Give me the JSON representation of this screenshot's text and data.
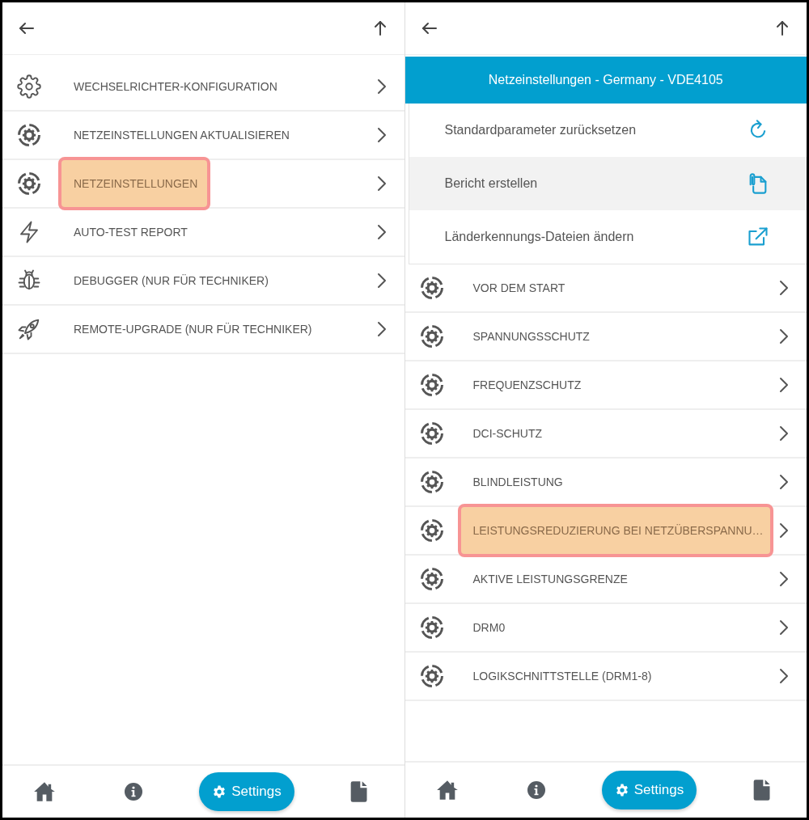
{
  "panels": [
    {
      "items": [
        {
          "label": "WECHSELRICHTER-KONFIGURATION",
          "kind": "gear",
          "highlighted": false
        },
        {
          "label": "NETZEINSTELLUNGEN AKTUALISIEREN",
          "kind": "gear-ring",
          "highlighted": false
        },
        {
          "label": "NETZEINSTELLUNGEN",
          "kind": "gear-ring",
          "highlighted": true
        },
        {
          "label": "AUTO-TEST REPORT",
          "kind": "bolt",
          "highlighted": false
        },
        {
          "label": "DEBUGGER (NUR FÜR TECHNIKER)",
          "kind": "bug",
          "highlighted": false
        },
        {
          "label": "REMOTE-UPGRADE (NUR FÜR TECHNIKER)",
          "kind": "rocket",
          "highlighted": false
        }
      ],
      "nav": [
        {
          "kind": "home",
          "selected": false
        },
        {
          "kind": "info",
          "selected": false
        },
        {
          "kind": "settings",
          "label": "Settings",
          "selected": true
        },
        {
          "kind": "file",
          "selected": false
        }
      ]
    },
    {
      "title_bar": "Netzeinstellungen - Germany - VDE4105",
      "actions": [
        {
          "label": "Standardparameter zurücksetzen",
          "kind": "refresh",
          "selected": false
        },
        {
          "label": "Bericht erstellen",
          "kind": "clip-doc",
          "selected": true
        },
        {
          "label": "Länderkennungs-Dateien ändern",
          "kind": "external",
          "selected": false
        }
      ],
      "items": [
        {
          "label": "VOR DEM START",
          "kind": "gear-ring",
          "highlighted": false
        },
        {
          "label": "SPANNUNGSSCHUTZ",
          "kind": "gear-ring",
          "highlighted": false
        },
        {
          "label": "FREQUENZSCHUTZ",
          "kind": "gear-ring",
          "highlighted": false
        },
        {
          "label": "DCI-SCHUTZ",
          "kind": "gear-ring",
          "highlighted": false
        },
        {
          "label": "BLINDLEISTUNG",
          "kind": "gear-ring",
          "highlighted": false
        },
        {
          "label": "LEISTUNGSREDUZIERUNG BEI NETZÜBERSPANNU…",
          "kind": "gear-ring",
          "highlighted": true
        },
        {
          "label": "AKTIVE LEISTUNGSGRENZE",
          "kind": "gear-ring",
          "highlighted": false
        },
        {
          "label": "DRM0",
          "kind": "gear-ring",
          "highlighted": false
        },
        {
          "label": "LOGIKSCHNITTSTELLE (DRM1-8)",
          "kind": "gear-ring",
          "highlighted": false
        }
      ],
      "nav": [
        {
          "kind": "home",
          "selected": false
        },
        {
          "kind": "info",
          "selected": false
        },
        {
          "kind": "settings",
          "label": "Settings",
          "selected": true
        },
        {
          "kind": "file",
          "selected": false
        }
      ]
    }
  ]
}
